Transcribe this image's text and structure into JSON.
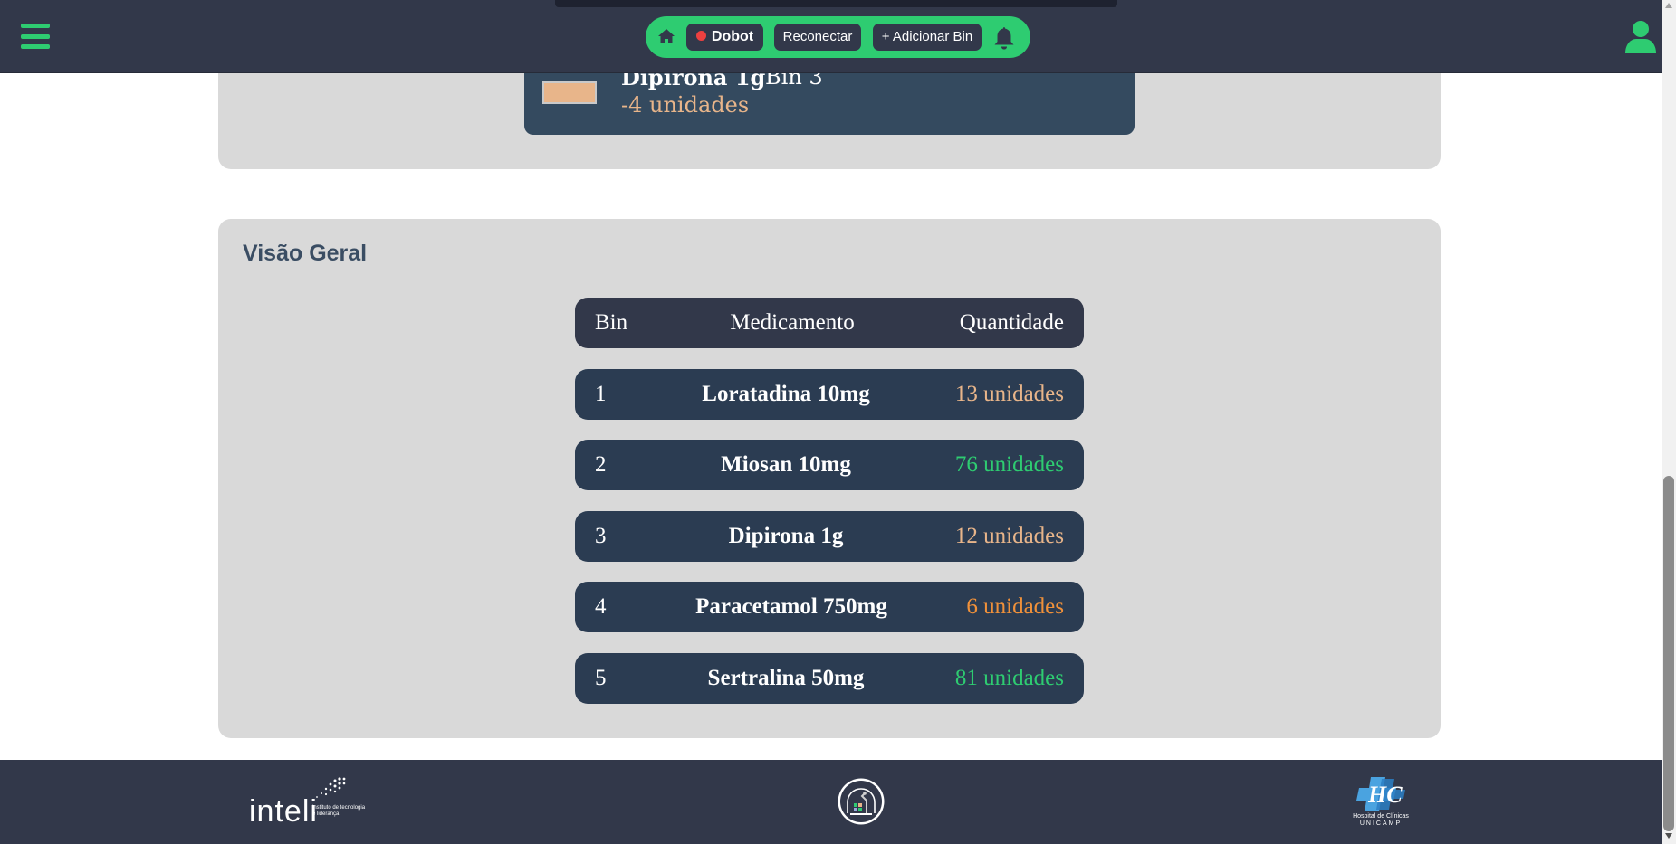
{
  "header": {
    "robot_label": "Dobot",
    "reconnect_label": "Reconectar",
    "add_bin_label": "+ Adicionar Bin",
    "accent_color": "#2ecc71",
    "status_color": "#ee4040"
  },
  "log_entry": {
    "medication": "Dipirona 1g",
    "bin": "Bin 3",
    "quantity": "-4 unidades"
  },
  "overview": {
    "title": "Visão Geral",
    "columns": [
      "Bin",
      "Medicamento",
      "Quantidade"
    ],
    "rows": [
      {
        "bin": "1",
        "medication": "Loratadina 10mg",
        "quantity": "13 unidades",
        "color": "#e8b58a"
      },
      {
        "bin": "2",
        "medication": "Miosan 10mg",
        "quantity": "76 unidades",
        "color": "#2ecc71"
      },
      {
        "bin": "3",
        "medication": "Dipirona 1g",
        "quantity": "12 unidades",
        "color": "#e8b58a"
      },
      {
        "bin": "4",
        "medication": "Paracetamol 750mg",
        "quantity": "6 unidades",
        "color": "#f0913a"
      },
      {
        "bin": "5",
        "medication": "Sertralina 50mg",
        "quantity": "81 unidades",
        "color": "#2ecc71"
      }
    ]
  },
  "footer": {
    "inteli_word": "inteli",
    "inteli_sub": "instituto de tecnologia e liderança",
    "hc_text_1": "Hospital de Clínicas",
    "hc_text_2": "UNICAMP"
  }
}
